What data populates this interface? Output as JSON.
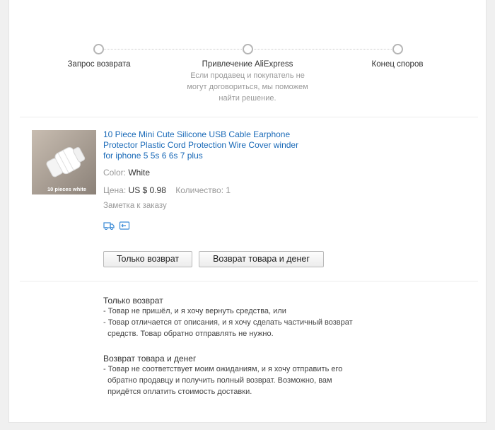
{
  "steps": [
    {
      "label": "Запрос возврата"
    },
    {
      "label": "Привлечение AliExpress",
      "description_lines": [
        "Если продавец и покупатель не",
        "могут договориться, мы поможем",
        "найти решение."
      ]
    },
    {
      "label": "Конец споров"
    }
  ],
  "product": {
    "image_caption": "10 pieces white",
    "title_lines": [
      "10 Piece Mini Cute Silicone USB Cable Earphone",
      "Protector Plastic Cord Protection Wire Cover winder",
      "for iphone 5 5s 6 6s 7 plus"
    ],
    "color_label": "Color:",
    "color_value": "White",
    "price_label": "Цена:",
    "price_value": "US $ 0.98",
    "quantity_label": "Количество:",
    "quantity_value": "1",
    "note_label": "Заметка к заказу"
  },
  "buttons": {
    "refund_only": "Только возврат",
    "return_and_refund": "Возврат товара и денег"
  },
  "explanations": {
    "refund_only_title": "Только возврат",
    "refund_only_lines": [
      "- Товар не пришёл, и я хочу вернуть средства, или",
      "- Товар отличается от описания, и я хочу сделать частичный возврат",
      "  средств. Товар обратно отправлять не нужно."
    ],
    "return_title": "Возврат товара и денег",
    "return_lines": [
      "- Товар не соответствует моим ожиданиям, и я хочу отправить его",
      "  обратно продавцу и получить полный возврат. Возможно, вам",
      "  придётся оплатить стоимость доставки."
    ]
  },
  "icons": [
    "delivery-truck-icon",
    "shipping-box-icon"
  ],
  "colors": {
    "link": "#1a6ab8",
    "muted": "#999999",
    "background": "#f0f0f0"
  }
}
